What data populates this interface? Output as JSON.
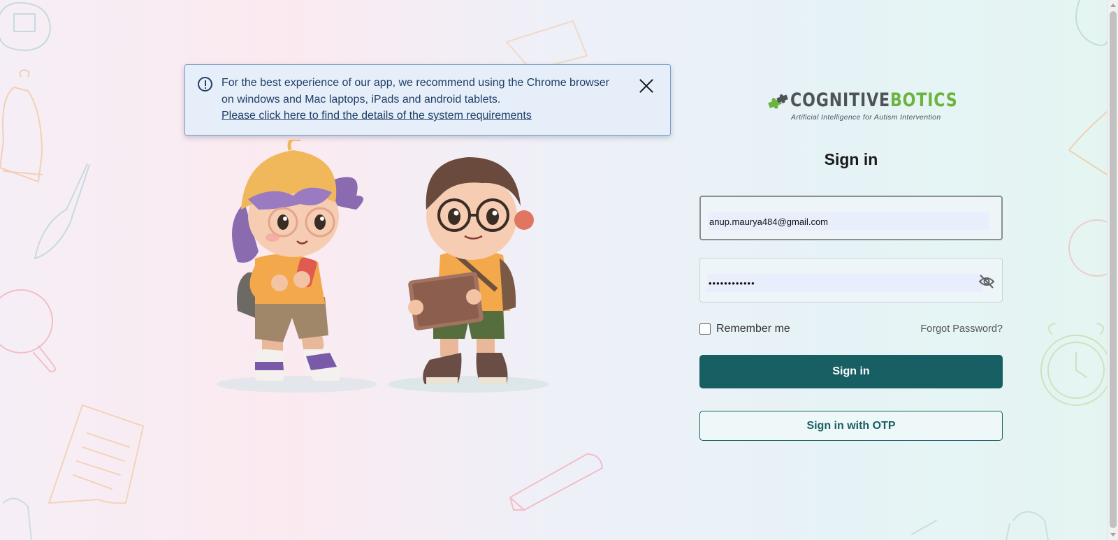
{
  "notice": {
    "line1": "For the best experience of our app, we recommend using the Chrome browser",
    "line2": "on windows and Mac laptops, iPads and android tablets.",
    "link": "Please click here to find the details of the system requirements",
    "icon": "info-icon",
    "close_icon": "close-icon"
  },
  "logo": {
    "brand_part1": "COGNITIVE",
    "brand_part2": "BOTICS",
    "tagline": "Artificial Intelligence for Autism Intervention",
    "colors": {
      "gray": "#4e5358",
      "green": "#6cb33f"
    }
  },
  "form": {
    "title": "Sign in",
    "email_value": "anup.maurya484@gmail.com",
    "password_value": "••••••••••••",
    "password_toggle_icon": "eye-slash-icon",
    "remember_label": "Remember me",
    "remember_checked": false,
    "forgot_label": "Forgot Password?",
    "signin_label": "Sign in",
    "otp_label": "Sign in with OTP"
  },
  "theme": {
    "primary": "#175f63",
    "notice_bg": "#e6eefa",
    "notice_text": "#1f3f66"
  }
}
